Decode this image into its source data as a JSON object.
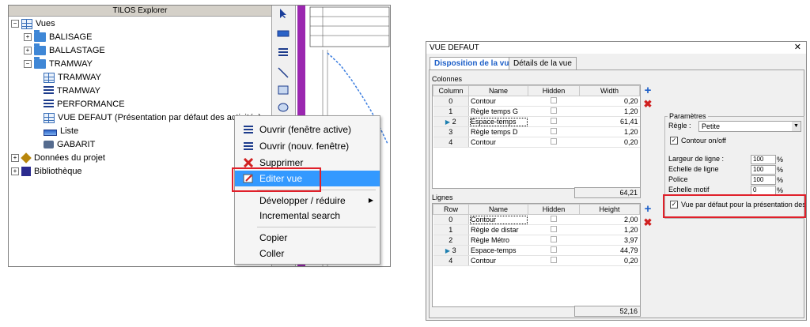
{
  "explorer": {
    "title": "TILOS Explorer",
    "tree": [
      {
        "label": "Vues",
        "toggle": "−",
        "icon": "grid-icon"
      },
      {
        "label": "BALISAGE",
        "toggle": "+",
        "icon": "folder-icon"
      },
      {
        "label": "BALLASTAGE",
        "toggle": "+",
        "icon": "folder-icon"
      },
      {
        "label": "TRAMWAY",
        "toggle": "−",
        "icon": "folder-icon"
      },
      {
        "label": "TRAMWAY",
        "icon": "grid-icon"
      },
      {
        "label": "TRAMWAY",
        "icon": "lines-icon"
      },
      {
        "label": "PERFORMANCE",
        "icon": "lines-icon"
      },
      {
        "label": "VUE DEFAUT (Présentation par défaut des activités)",
        "icon": "grid-icon"
      },
      {
        "label": "Liste",
        "icon": "bar-icon"
      },
      {
        "label": "GABARIT",
        "icon": "print-icon"
      },
      {
        "label": "Données du projet",
        "toggle": "+",
        "icon": "data-icon"
      },
      {
        "label": "Bibliothèque",
        "toggle": "+",
        "icon": "library-icon"
      }
    ]
  },
  "context_menu": {
    "items": [
      {
        "label": "Ouvrir (fenêtre active)",
        "icon": "open-icon"
      },
      {
        "label": "Ouvrir (nouv. fenêtre)",
        "icon": "open-new-icon"
      },
      {
        "label": "Supprimer",
        "icon": "delete-icon"
      },
      {
        "label": "Editer vue",
        "icon": "edit-icon"
      },
      {
        "label": "Développer / réduire",
        "submenu_arrow": "▶"
      },
      {
        "label": "Incremental search"
      },
      {
        "label": "Copier"
      },
      {
        "label": "Coller"
      }
    ]
  },
  "dialog": {
    "title": "VUE DEFAUT",
    "close": "✕",
    "tabs": [
      "Disposition de la vue",
      "Détails de la vue"
    ],
    "columns": {
      "section_label": "Colonnes",
      "headers": [
        "Column",
        "Name",
        "Hidden",
        "Width"
      ],
      "rows": [
        {
          "index": "0",
          "name": "Contour",
          "width": "0,20"
        },
        {
          "index": "1",
          "name": "Règle temps G",
          "width": "1,20"
        },
        {
          "index": "2",
          "name": "Espace-temps",
          "width": "61,41"
        },
        {
          "index": "3",
          "name": "Règle temps D",
          "width": "1,20"
        },
        {
          "index": "4",
          "name": "Contour",
          "width": "0,20"
        }
      ],
      "total": "64,21"
    },
    "lines": {
      "section_label": "Lignes",
      "headers": [
        "Row",
        "Name",
        "Hidden",
        "Height"
      ],
      "rows": [
        {
          "index": "0",
          "name": "Contour",
          "height": "2,00"
        },
        {
          "index": "1",
          "name": "Règle de distar",
          "height": "1,20"
        },
        {
          "index": "2",
          "name": "Règle Métro",
          "height": "3,97"
        },
        {
          "index": "3",
          "name": "Espace-temps",
          "height": "44,79"
        },
        {
          "index": "4",
          "name": "Contour",
          "height": "0,20"
        }
      ],
      "total": "52,16"
    },
    "params": {
      "legend": "Paramètres",
      "regle_label": "Règle :",
      "regle_value": "Petite",
      "contour_label": "Contour on/off",
      "largeur_label": "Largeur de ligne :",
      "largeur_value": "100",
      "echelle_ligne_label": "Echelle de ligne",
      "echelle_ligne_value": "100",
      "police_label": "Police",
      "police_value": "100",
      "echelle_motif_label": "Echelle motif",
      "echelle_motif_value": "0",
      "unit": "%",
      "default_view_label": "Vue par défaut pour la présentation des"
    }
  },
  "colors": {
    "highlight": "#3399ff",
    "annotation": "#e0202a",
    "accent_purple": "#9b27b0"
  }
}
